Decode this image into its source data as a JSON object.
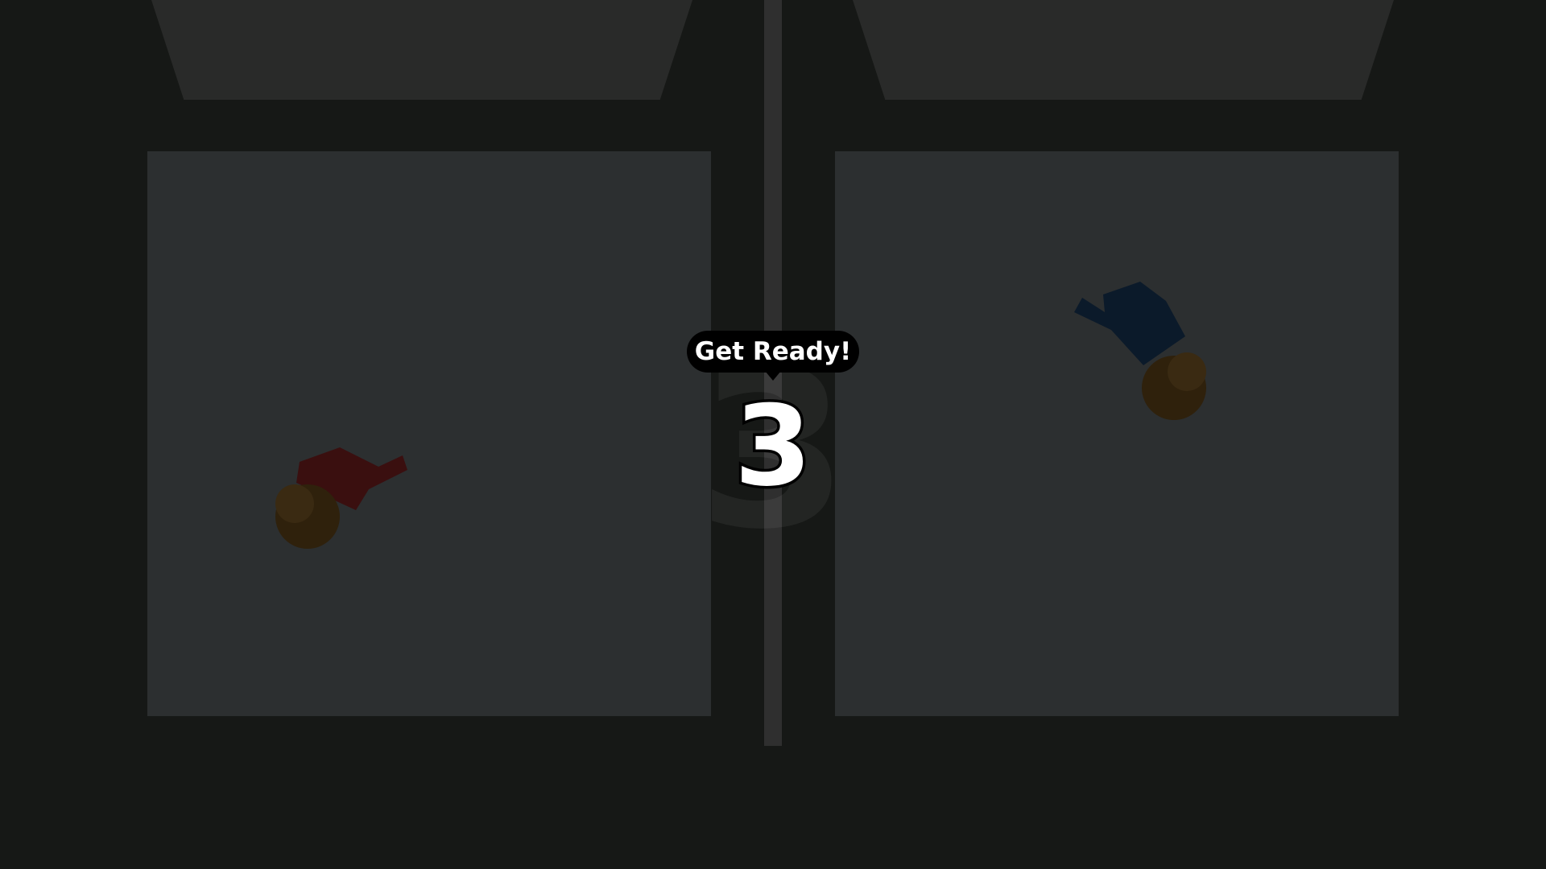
{
  "hud": {
    "ready_text": "Get Ready!",
    "countdown_value": "3",
    "countdown_shadow": "3"
  },
  "colors": {
    "background": "#161816",
    "arena_floor": "#2c2f30",
    "goal_zone": "#292a29",
    "divider": "#2f2f2f",
    "player_left_shirt": "#3a0f0f",
    "player_right_shirt": "#0b1a2a",
    "player_head": "#3a2a12"
  },
  "players": [
    {
      "side": "left",
      "team_color": "red"
    },
    {
      "side": "right",
      "team_color": "blue"
    }
  ]
}
